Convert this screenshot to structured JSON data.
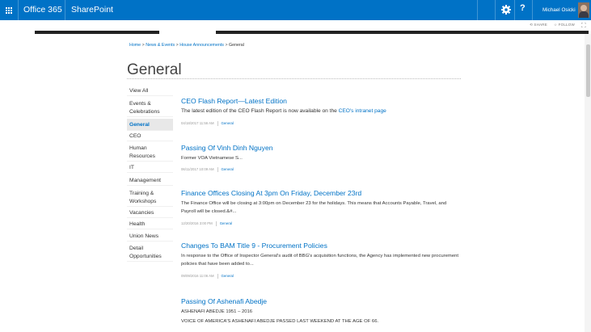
{
  "suite_bar": {
    "brand": "Office 365",
    "app": "SharePoint",
    "help": "?",
    "user_name": "Michael Osicki",
    "accent_color": "#0072c6",
    "icons": [
      "app-launcher-icon",
      "settings-gear-icon",
      "help-icon",
      "user-avatar"
    ]
  },
  "page_actions": {
    "share": "SHARE",
    "follow": "FOLLOW",
    "focus": "⛶"
  },
  "breadcrumb": {
    "home": "Home",
    "news": "News & Events",
    "announcements": "House Announcements",
    "current": "General",
    "separator": ">"
  },
  "page_title": "General",
  "left_nav": [
    {
      "label": "View All"
    },
    {
      "label": "Events & Celebrations"
    },
    {
      "label": "General",
      "selected": true
    },
    {
      "label": "CEO"
    },
    {
      "label": "Human Resources"
    },
    {
      "label": "IT"
    },
    {
      "label": "Management"
    },
    {
      "label": "Training & Workshops"
    },
    {
      "label": "Vacancies"
    },
    {
      "label": "Health"
    },
    {
      "label": "Union News"
    },
    {
      "label": "Detail Opportunities"
    }
  ],
  "posts": [
    {
      "title": "CEO Flash Report—Latest Edition",
      "body": "The latest edition of the CEO Flash Report is now available on the ",
      "body_link": "CEO's intranet page",
      "date": "04/18/2017 11:56 AM",
      "category": "General"
    },
    {
      "title": "Passing Of Vinh Dinh Nguyen",
      "body": "Former VOA Vietnamese S...",
      "date": "06/11/2017 10:09 AM",
      "category": "General"
    },
    {
      "title": "Finance Offices Closing At 3pm On Friday, December 23rd",
      "body": "The Finance Office will be closing at 3:00pm on December 23 for the holidays.  This means that Accounts Payable, Travel, and Payroll will be closed.&#...",
      "date": "12/20/2016 3:00 PM",
      "category": "General"
    },
    {
      "title": "Changes To BAM Title 9 - Procurement Policies",
      "body": "In response to the Office of Inspector General's audit of BBG's acquisition functions, the Agency has implemented new procurement policies that have been added to...",
      "date": "09/09/2016 11:06 AM",
      "category": "General"
    },
    {
      "title": "Passing Of Ashenafi Abedje",
      "body": "ASHENAFI ABEDJE 1951 – 2016",
      "body2": "VOICE OF AMERICA'S ASHENAFI ABEDJE PASSED LAST WEEKEND AT THE AGE OF 66."
    }
  ]
}
